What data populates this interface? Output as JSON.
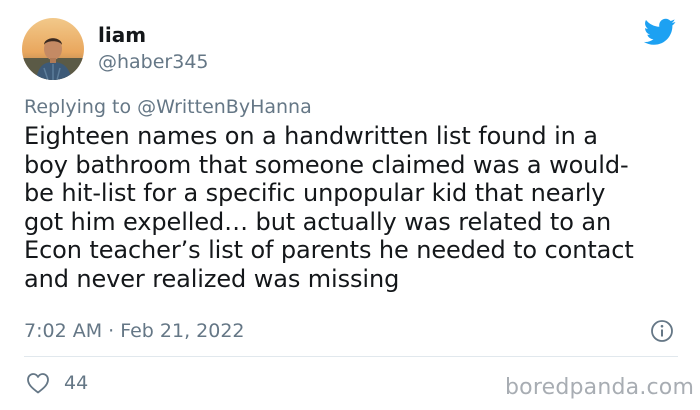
{
  "tweet": {
    "display_name": "liam",
    "handle": "@haber345",
    "replying_prefix": "Replying to ",
    "replying_to": "@WrittenByHanna",
    "body_lines": [
      "Eighteen names on a handwritten list found in a",
      "boy bathroom that someone claimed was a would-",
      "be hit-list for a specific unpopular kid that nearly",
      "got him expelled… but actually was related to an",
      "Econ teacher’s list of parents he needed to contact",
      "and never realized was missing"
    ],
    "timestamp": "7:02 AM · Feb 21, 2022",
    "like_count": "44"
  },
  "icons": {
    "brand": "twitter-bird-icon",
    "info": "info-icon",
    "like": "heart-icon"
  },
  "colors": {
    "twitter_blue": "#1da1f2",
    "secondary_text": "#657786",
    "primary_text": "#14171a",
    "divider": "#e1e8ed"
  },
  "watermark": "boredpanda.com"
}
